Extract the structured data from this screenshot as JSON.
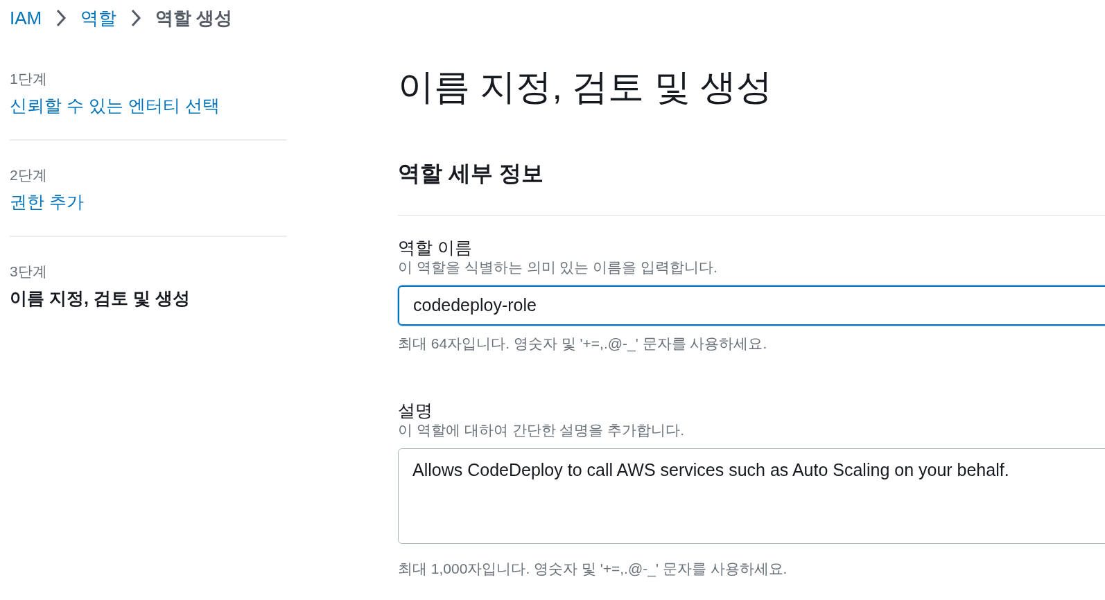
{
  "breadcrumb": [
    {
      "label": "IAM",
      "kind": "link"
    },
    {
      "label": "역할",
      "kind": "link"
    },
    {
      "label": "역할 생성",
      "kind": "current"
    }
  ],
  "steps": [
    {
      "step": "1단계",
      "title": "신뢰할 수 있는 엔터티 선택",
      "selected": false
    },
    {
      "step": "2단계",
      "title": "권한 추가",
      "selected": false
    },
    {
      "step": "3단계",
      "title": "이름 지정, 검토 및 생성",
      "selected": true
    }
  ],
  "page_title": "이름 지정, 검토 및 생성",
  "section_title": "역할 세부 정보",
  "fields": [
    {
      "kind": "input",
      "label": "역할 이름",
      "description": "이 역할을 식별하는 의미 있는 이름을 입력합니다.",
      "value": "codedeploy-role",
      "focused": true,
      "hint": "최대 64자입니다. 영숫자 및 '+=,.@-_' 문자를 사용하세요."
    },
    {
      "kind": "textarea",
      "label": "설명",
      "description": "이 역할에 대하여 간단한 설명을 추가합니다.",
      "value": "Allows CodeDeploy to call AWS services such as Auto Scaling on your behalf.",
      "focused": false,
      "hint": "최대 1,000자입니다. 영숫자 및 '+=,.@-_' 문자를 사용하세요."
    }
  ]
}
